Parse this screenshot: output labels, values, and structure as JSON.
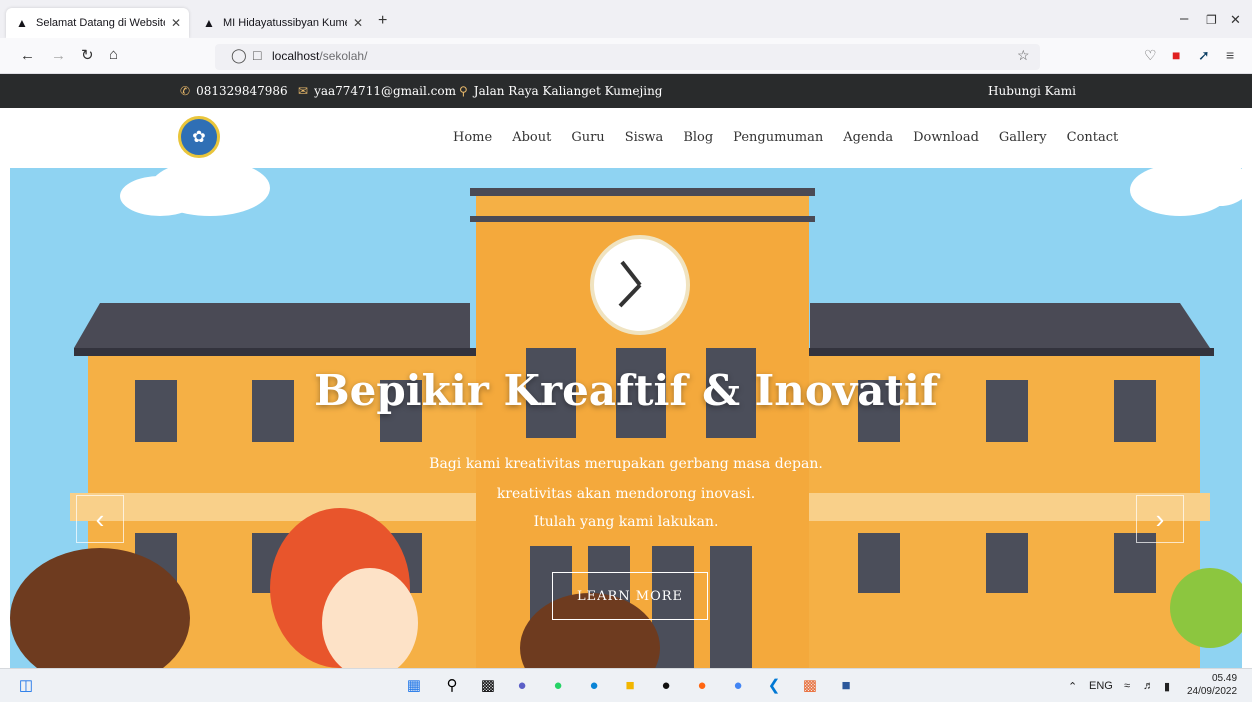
{
  "browser": {
    "tabs": [
      {
        "icon": "graduation-cap-icon",
        "title": "Selamat Datang di Website Sek"
      },
      {
        "icon": "graduation-cap-icon",
        "title": "MI Hidayatussibyan Kumejing |"
      }
    ],
    "url_host": "localhost",
    "url_path": "/sekolah/"
  },
  "site": {
    "topbar": {
      "phone": "081329847986",
      "email": "yaa774711@gmail.com",
      "address": "Jalan Raya Kalianget Kumejing",
      "contact_link": "Hubungi Kami"
    },
    "menu": [
      "Home",
      "About",
      "Guru",
      "Siswa",
      "Blog",
      "Pengumuman",
      "Agenda",
      "Download",
      "Gallery",
      "Contact"
    ],
    "hero": {
      "title": "Bepikir Kreaftif & Inovatif",
      "lines": [
        "Bagi kami kreativitas merupakan gerbang masa depan.",
        "kreativitas akan mendorong inovasi.",
        "Itulah yang kami lakukan."
      ],
      "button": "LEARN MORE"
    }
  },
  "taskbar": {
    "lang": "ENG",
    "time": "05.49",
    "date": "24/09/2022"
  },
  "colors": {
    "topbar_bg": "#292b2c",
    "accent": "#e6b76a",
    "sky": "#8fd3f2",
    "building": "#f5b045",
    "roof": "#4a4a55"
  }
}
